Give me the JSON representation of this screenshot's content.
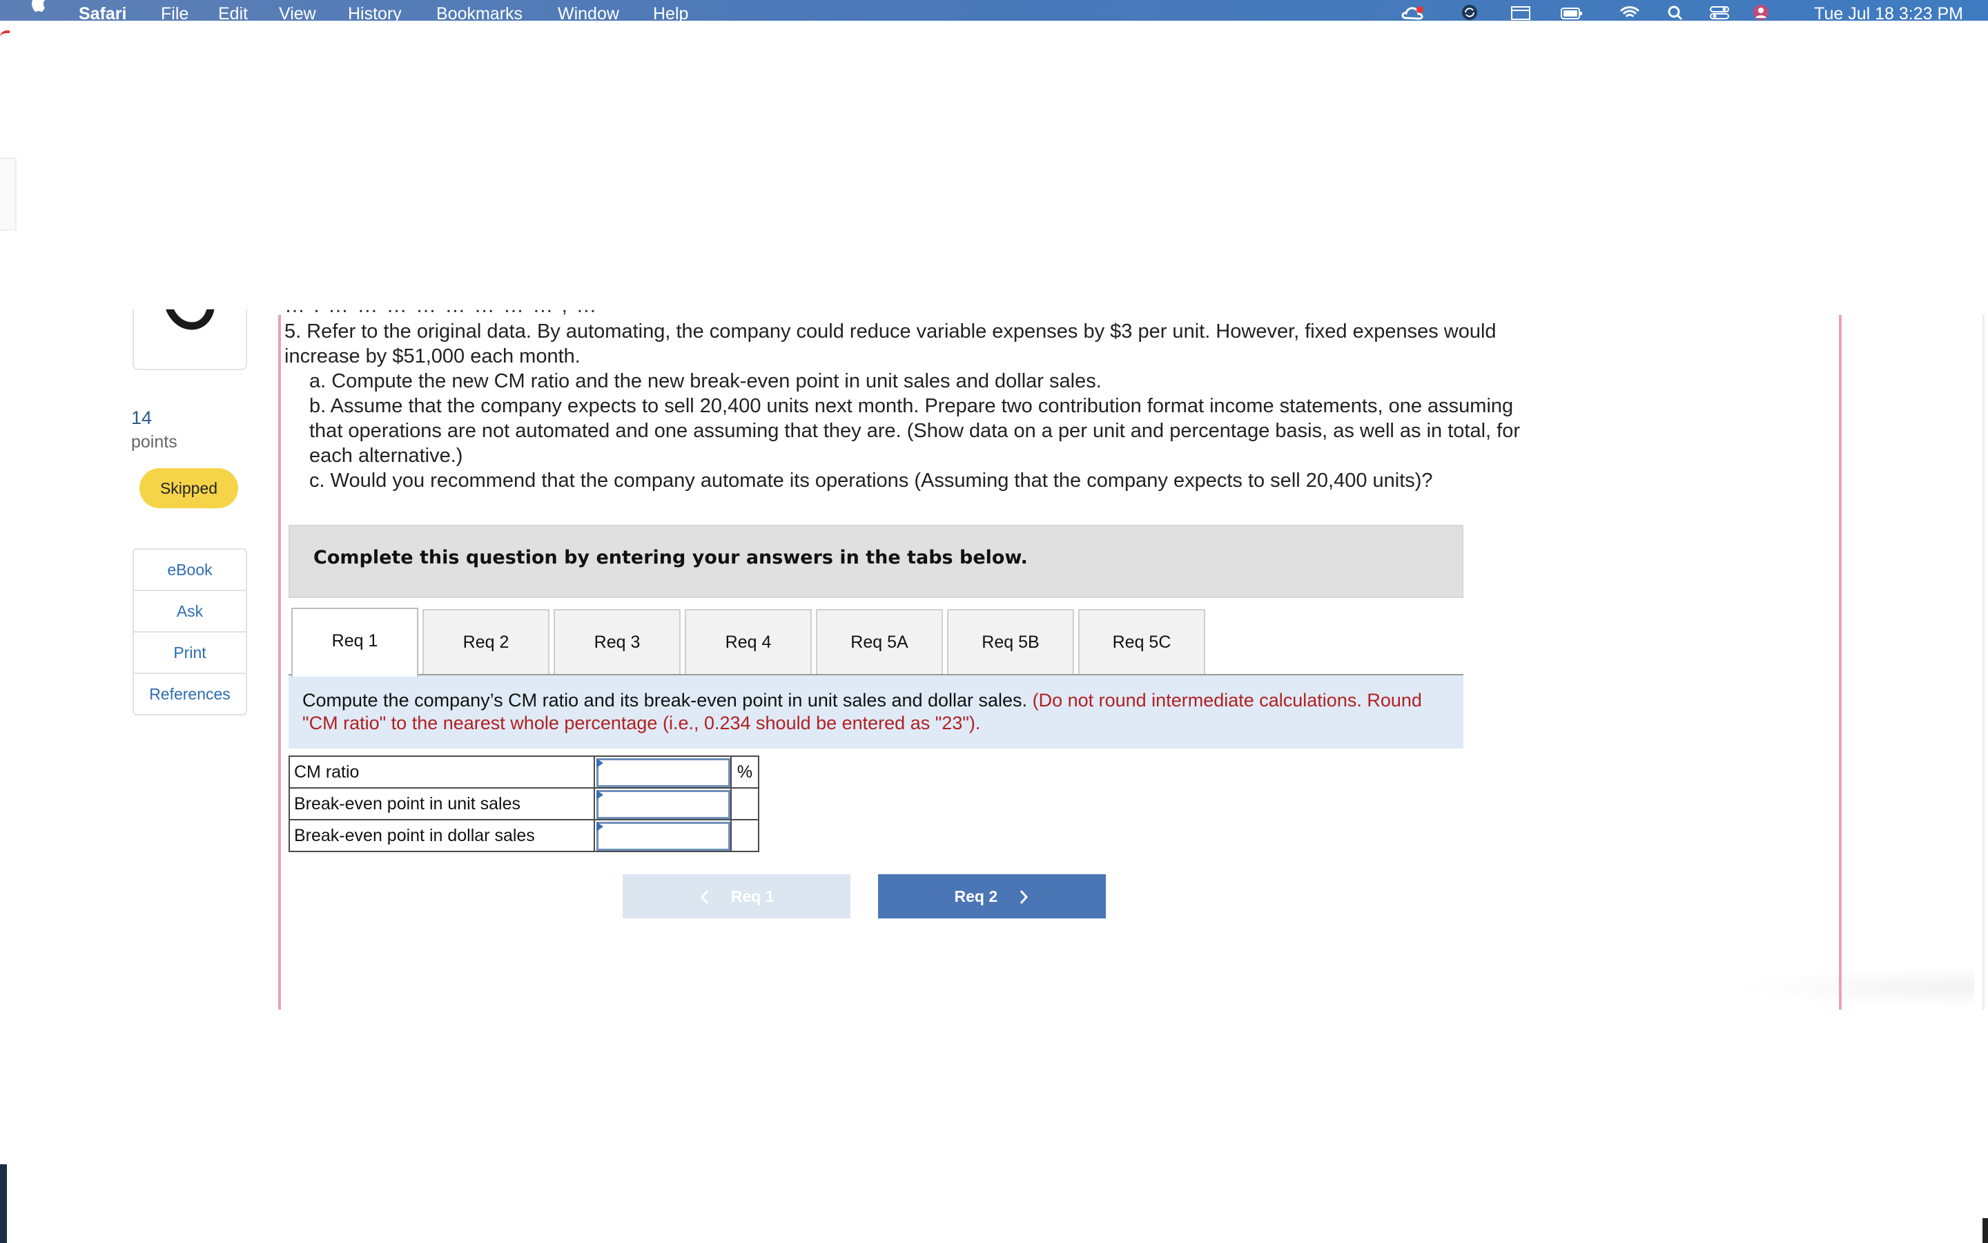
{
  "menubar": {
    "app_name": "Safari",
    "menus": [
      "File",
      "Edit",
      "View",
      "History",
      "Bookmarks",
      "Window",
      "Help"
    ],
    "tray_icons": [
      "creative-cloud-icon",
      "sync-icon",
      "window-icon",
      "battery-icon",
      "wifi-icon",
      "spotlight-search-icon",
      "control-center-icon",
      "user-avatar-icon"
    ],
    "clock": "Tue Jul 18  3:23 PM"
  },
  "sidebar": {
    "points_value": "14",
    "points_label": "points",
    "status": "Skipped",
    "resources": [
      "eBook",
      "Ask",
      "Print",
      "References"
    ]
  },
  "question": {
    "cut_off_line": "… . … … … … … … … … , …",
    "part5_intro": "5. Refer to the original data. By automating, the company could reduce variable expenses by $3 per unit. However, fixed expenses would increase by $51,000 each month.",
    "part5_a": "a. Compute the new CM ratio and the new break-even point in unit sales and dollar sales.",
    "part5_b": "b. Assume that the company expects to sell 20,400 units next month. Prepare two contribution format income statements, one assuming that operations are not automated and one assuming that they are. (Show data on a per unit and percentage basis, as well as in total, for each alternative.)",
    "part5_c": "c. Would you recommend that the company automate its operations (Assuming that the company expects to sell 20,400 units)?"
  },
  "banner": {
    "text": "Complete this question by entering your answers in the tabs below."
  },
  "tabs": [
    "Req 1",
    "Req 2",
    "Req 3",
    "Req 4",
    "Req 5A",
    "Req 5B",
    "Req 5C"
  ],
  "active_tab": "Req 1",
  "instructions": {
    "main": "Compute the company’s CM ratio and its break-even point in unit sales and dollar sales.",
    "note": "(Do not round intermediate calculations. Round \"CM ratio\" to the nearest whole percentage (i.e., 0.234 should be entered as \"23\")."
  },
  "answer_table": {
    "rows": [
      {
        "label": "CM ratio",
        "value": "",
        "unit": "%"
      },
      {
        "label": "Break-even point in unit sales",
        "value": "",
        "unit": ""
      },
      {
        "label": "Break-even point in dollar sales",
        "value": "",
        "unit": ""
      }
    ]
  },
  "nav": {
    "prev_label": "Req 1",
    "next_label": "Req 2"
  },
  "colors": {
    "accent_blue": "#4a76b5",
    "skipped_badge": "#f5d448",
    "instruction_bg": "#dfeaf6",
    "note_red": "#b22020",
    "frame_pink": "#e9a0bf"
  }
}
